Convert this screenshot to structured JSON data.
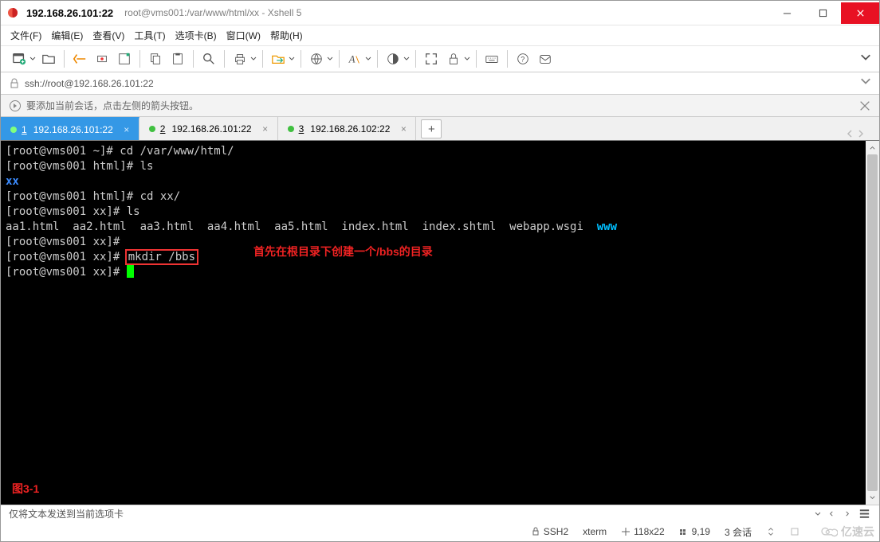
{
  "title": {
    "main": "192.168.26.101:22",
    "sub": "root@vms001:/var/www/html/xx - Xshell 5"
  },
  "menu": {
    "items": [
      "文件(F)",
      "编辑(E)",
      "查看(V)",
      "工具(T)",
      "选项卡(B)",
      "窗口(W)",
      "帮助(H)"
    ]
  },
  "address": {
    "url": "ssh://root@192.168.26.101:22"
  },
  "hint": {
    "text": "要添加当前会话，点击左侧的箭头按钮。"
  },
  "tabs": {
    "items": [
      {
        "num": "1",
        "label": "192.168.26.101:22",
        "active": true
      },
      {
        "num": "2",
        "label": "192.168.26.101:22",
        "active": false
      },
      {
        "num": "3",
        "label": "192.168.26.102:22",
        "active": false
      }
    ]
  },
  "terminal": {
    "lines": {
      "p1": "[root@vms001 ~]# ",
      "c1": "cd /var/www/html/",
      "p2": "[root@vms001 html]# ",
      "c2": "ls",
      "xx": "xx",
      "p3": "[root@vms001 html]# ",
      "c3": "cd xx/",
      "p4": "[root@vms001 xx]# ",
      "c4": "ls",
      "files": "aa1.html  aa2.html  aa3.html  aa4.html  aa5.html  index.html  index.shtml  webapp.wsgi  ",
      "www": "www",
      "p5": "[root@vms001 xx]# ",
      "p6": "[root@vms001 xx]# ",
      "c6": "mkdir /bbs",
      "p7": "[root@vms001 xx]# "
    },
    "annotation": "首先在根目录下创建一个/bbs的目录",
    "figLabel": "图3-1"
  },
  "statusbar": {
    "left": "仅将文本发送到当前选项卡"
  },
  "bottom": {
    "protocol": "SSH2",
    "term": "xterm",
    "size": "118x22",
    "pos": "9,19",
    "sessions": "3 会话"
  },
  "watermark": "亿速云"
}
